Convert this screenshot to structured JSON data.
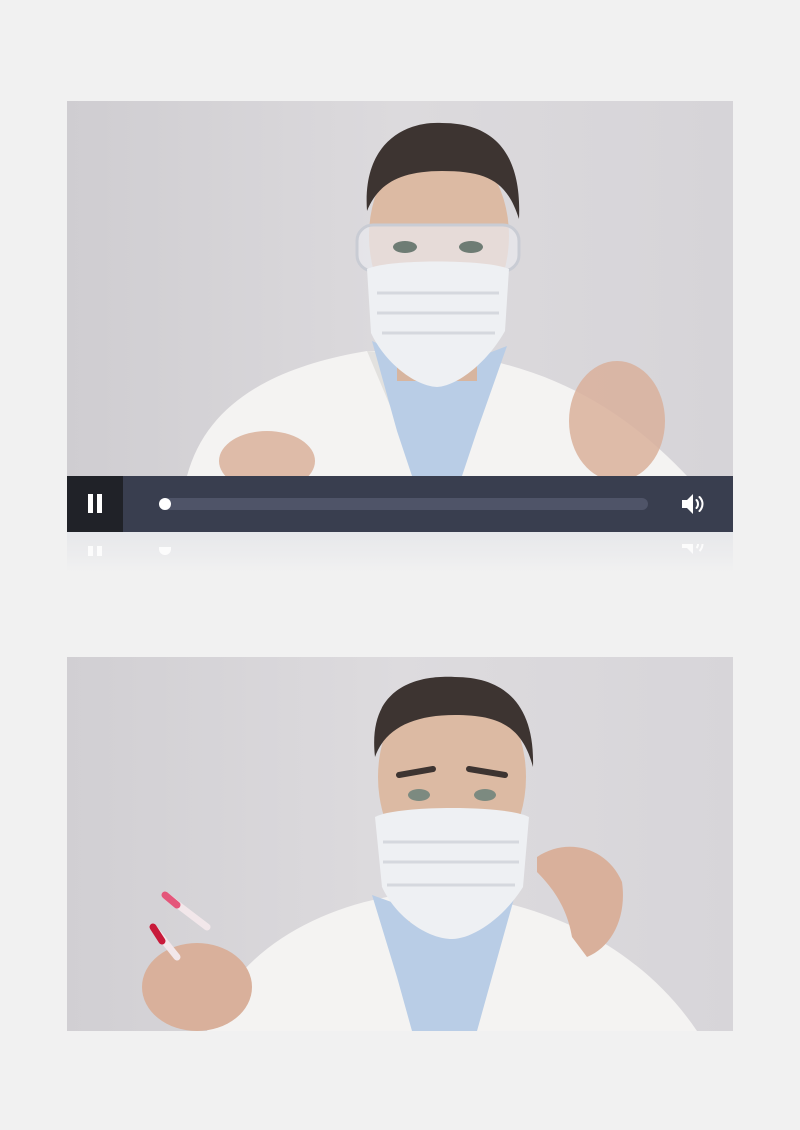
{
  "player": {
    "state": "playing",
    "progress": 0.0,
    "controls": {
      "pause_icon": "pause-icon",
      "volume_icon": "speaker-volume-icon"
    }
  },
  "frames": [
    {
      "subject": "scientist-in-safety-goggles-and-mask",
      "icon": "video-frame"
    },
    {
      "subject": "scientist-in-mask-holding-test-tubes",
      "icon": "video-frame"
    }
  ],
  "colors": {
    "page_bg": "#f1f1f1",
    "bar_bg": "#393e4f",
    "button_bg": "#202228",
    "track": "#4f5468",
    "knob": "#ffffff"
  }
}
